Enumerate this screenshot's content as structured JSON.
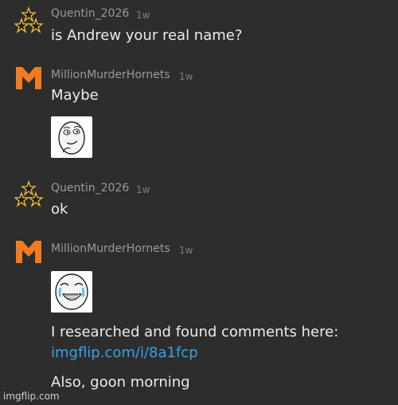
{
  "comments": [
    {
      "user": "Quentin_2026",
      "time": "1w",
      "text": "is Andrew your real name?"
    },
    {
      "user": "MillionMurderHornets",
      "time": "1w",
      "text": "Maybe"
    },
    {
      "user": "Quentin_2026",
      "time": "1w",
      "text": "ok"
    },
    {
      "user": "MillionMurderHornets",
      "time": "1w",
      "text1": "I researched and found comments here:",
      "link": "imgflip.com/i/8a1fcp",
      "text2": "Also, goon morning"
    }
  ],
  "watermark": "imgflip.com",
  "colors": {
    "background": "#2d2d2d",
    "link": "#3aa0e8",
    "hornet_logo": "#f07b20"
  }
}
